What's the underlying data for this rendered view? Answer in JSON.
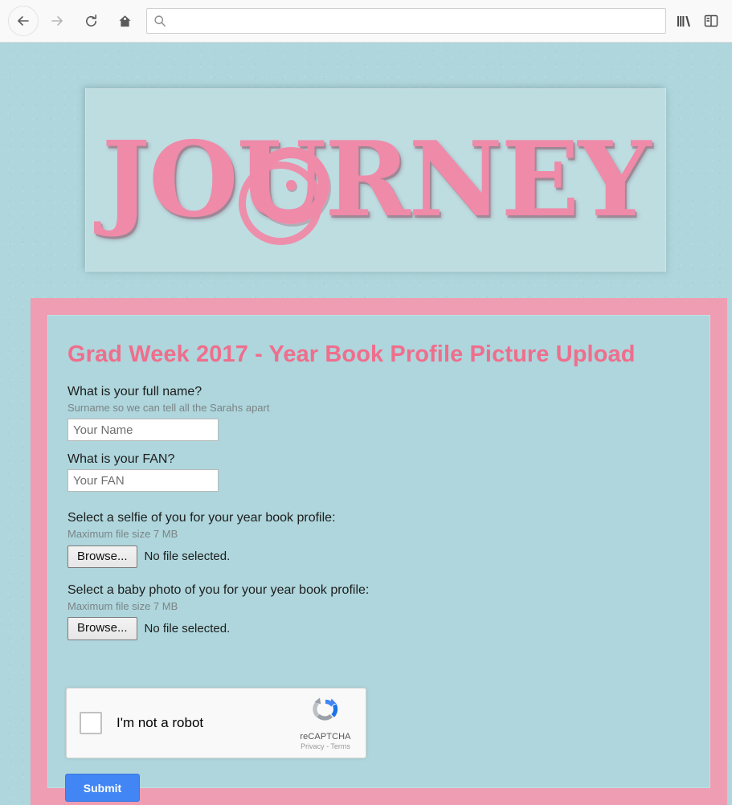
{
  "browser": {
    "back_label": "Back",
    "forward_label": "Forward",
    "reload_label": "Reload",
    "home_label": "Home",
    "library_label": "Library",
    "sidebar_label": "Sidebar",
    "urlbar": {
      "value": "",
      "placeholder": ""
    }
  },
  "site": {
    "logo_text": "JOURNEY",
    "background_color": "#aed6dc",
    "accent_pink": "#ef6e8c",
    "logo_pink": "#ef8aa8",
    "border_pink": "#ef9db2"
  },
  "form": {
    "title": "Grad Week 2017 - Year Book Profile Picture Upload",
    "fields": [
      {
        "label": "What is your full name?",
        "help": "Surname so we can tell all the Sarahs apart",
        "placeholder": "Your Name",
        "value": ""
      },
      {
        "label": "What is your FAN?",
        "help": "",
        "placeholder": "Your FAN",
        "value": ""
      }
    ],
    "uploads": [
      {
        "label": "Select a selfie of you for your year book profile:",
        "help": "Maximum file size 7 MB",
        "browse_label": "Browse...",
        "status": "No file selected."
      },
      {
        "label": "Select a baby photo of you for your year book profile:",
        "help": "Maximum file size 7 MB",
        "browse_label": "Browse...",
        "status": "No file selected."
      }
    ],
    "recaptcha": {
      "checkbox_label": "I'm not a robot",
      "brand": "reCAPTCHA",
      "privacy": "Privacy",
      "separator": " - ",
      "terms": "Terms"
    },
    "submit_label": "Submit"
  }
}
